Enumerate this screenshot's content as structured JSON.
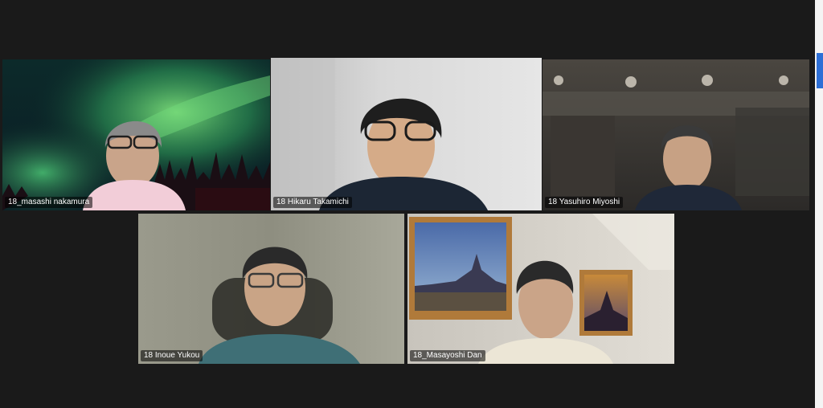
{
  "participants": [
    {
      "name": "18_masashi nakamura",
      "background": "aurora"
    },
    {
      "name": "18 Hikaru Takamichi",
      "background": "white-wall",
      "active_speaker": true
    },
    {
      "name": "18 Yasuhiro Miyoshi",
      "background": "dim-room"
    },
    {
      "name": "18 Inoue Yukou",
      "background": "blurred-room"
    },
    {
      "name": "18_Masayoshi Dan",
      "background": "room-with-paintings"
    }
  ],
  "colors": {
    "active_speaker_border": "#c8dc3c",
    "background": "#1a1a1a"
  }
}
